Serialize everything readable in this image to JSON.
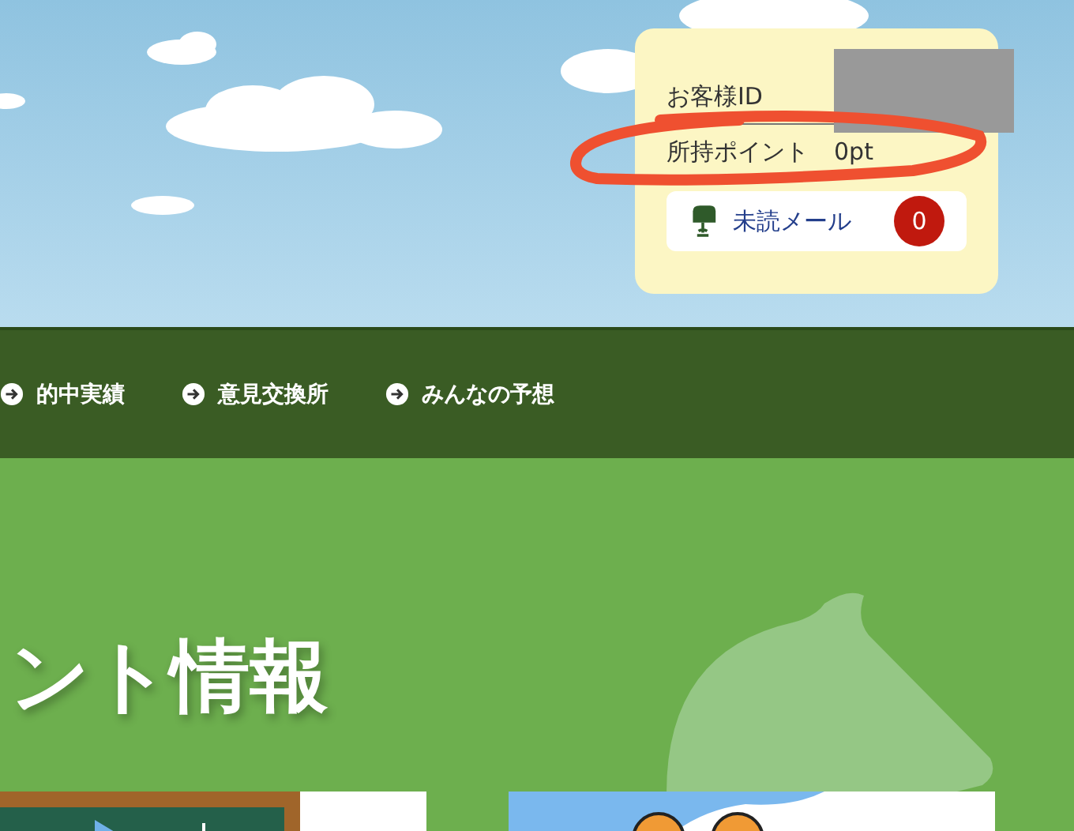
{
  "account": {
    "id_label": "お客様ID",
    "points_label": "所持ポイント",
    "points_value": "0pt",
    "mail_label": "未読メール",
    "mail_count": "0"
  },
  "nav": [
    {
      "label": "的中実績"
    },
    {
      "label": "意見交換所"
    },
    {
      "label": "みんなの予想"
    }
  ],
  "section": {
    "heading": "ント情報"
  }
}
